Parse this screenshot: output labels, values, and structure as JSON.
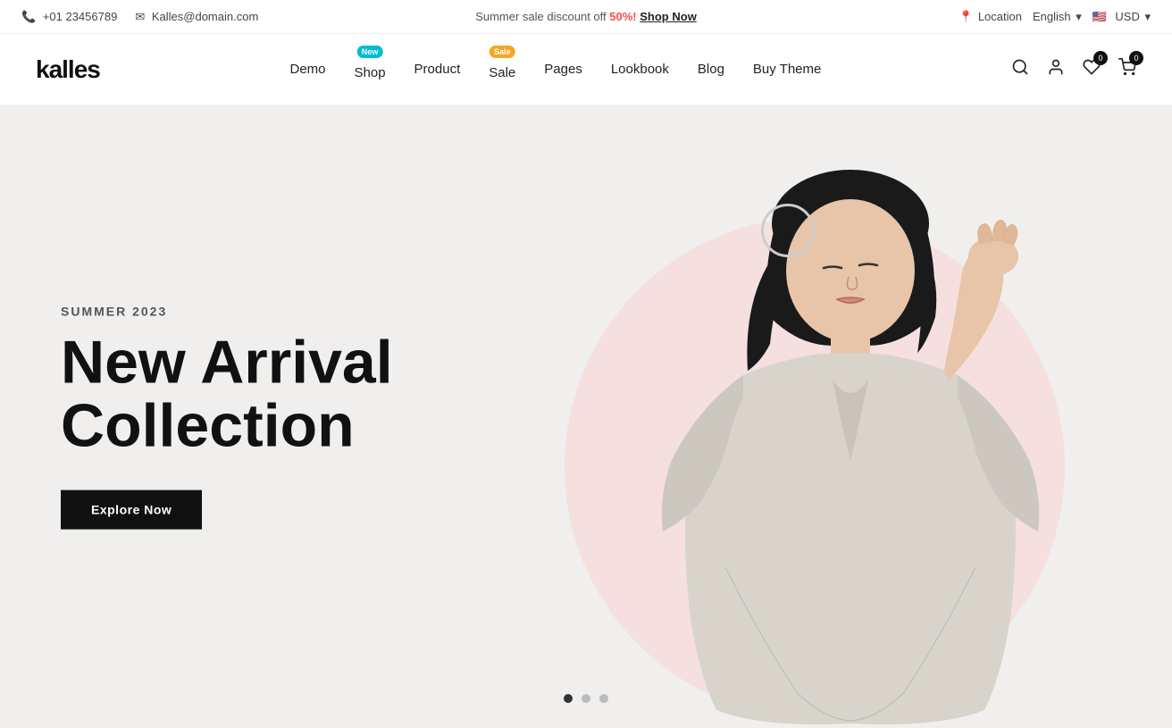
{
  "topbar": {
    "phone": "+01 23456789",
    "email": "Kalles@domain.com",
    "promo_text": "Summer sale discount off",
    "promo_percent": "50%!",
    "shop_now": "Shop Now",
    "location": "Location",
    "language": "English",
    "currency": "USD"
  },
  "header": {
    "logo": "kalles",
    "nav": [
      {
        "label": "Demo",
        "badge": null
      },
      {
        "label": "Shop",
        "badge": "New",
        "badge_type": "new"
      },
      {
        "label": "Product",
        "badge": null
      },
      {
        "label": "Sale",
        "badge": "Sale",
        "badge_type": "sale"
      },
      {
        "label": "Pages",
        "badge": null
      },
      {
        "label": "Lookbook",
        "badge": null
      },
      {
        "label": "Blog",
        "badge": null
      },
      {
        "label": "Buy Theme",
        "badge": null
      }
    ],
    "wishlist_count": "0",
    "cart_count": "0"
  },
  "hero": {
    "subtitle": "SUMMER 2023",
    "title": "New Arrival Collection",
    "cta": "Explore Now",
    "dots": [
      {
        "active": true
      },
      {
        "active": false
      },
      {
        "active": false
      }
    ]
  }
}
